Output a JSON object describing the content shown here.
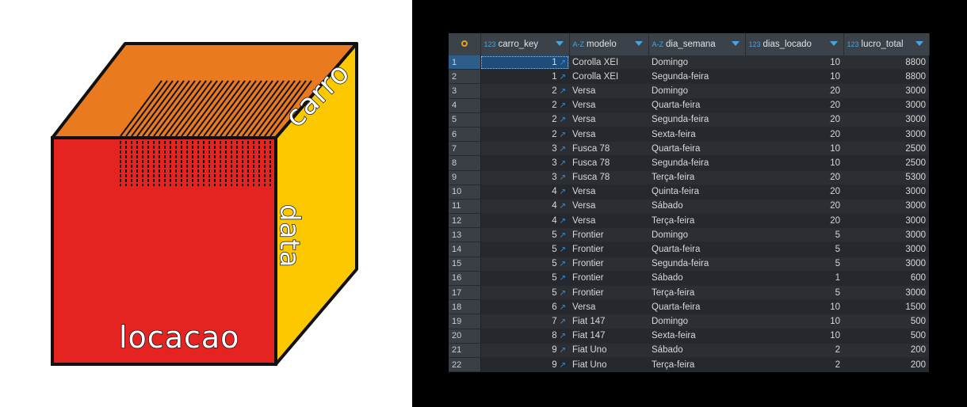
{
  "cube": {
    "labels": {
      "front": "locacao",
      "top": "carro",
      "side": "data"
    },
    "colors": {
      "front": "#e52421",
      "top": "#ea7a1f",
      "side": "#fcc800",
      "outline": "#111111"
    }
  },
  "grid": {
    "columns": [
      {
        "type": "123",
        "name": "carro_key"
      },
      {
        "type": "A-Z",
        "name": "modelo"
      },
      {
        "type": "A-Z",
        "name": "dia_semana"
      },
      {
        "type": "123",
        "name": "dias_locado"
      },
      {
        "type": "123",
        "name": "lucro_total"
      }
    ],
    "selected_row": 1,
    "rows": [
      {
        "n": "1",
        "carro_key": "1",
        "modelo": "Corolla XEI",
        "dia_semana": "Domingo",
        "dias_locado": "10",
        "lucro_total": "8800"
      },
      {
        "n": "2",
        "carro_key": "1",
        "modelo": "Corolla XEI",
        "dia_semana": "Segunda-feira",
        "dias_locado": "10",
        "lucro_total": "8800"
      },
      {
        "n": "3",
        "carro_key": "2",
        "modelo": "Versa",
        "dia_semana": "Domingo",
        "dias_locado": "20",
        "lucro_total": "3000"
      },
      {
        "n": "4",
        "carro_key": "2",
        "modelo": "Versa",
        "dia_semana": "Quarta-feira",
        "dias_locado": "20",
        "lucro_total": "3000"
      },
      {
        "n": "5",
        "carro_key": "2",
        "modelo": "Versa",
        "dia_semana": "Segunda-feira",
        "dias_locado": "20",
        "lucro_total": "3000"
      },
      {
        "n": "6",
        "carro_key": "2",
        "modelo": "Versa",
        "dia_semana": "Sexta-feira",
        "dias_locado": "20",
        "lucro_total": "3000"
      },
      {
        "n": "7",
        "carro_key": "3",
        "modelo": "Fusca 78",
        "dia_semana": "Quarta-feira",
        "dias_locado": "10",
        "lucro_total": "2500"
      },
      {
        "n": "8",
        "carro_key": "3",
        "modelo": "Fusca 78",
        "dia_semana": "Segunda-feira",
        "dias_locado": "10",
        "lucro_total": "2500"
      },
      {
        "n": "9",
        "carro_key": "3",
        "modelo": "Fusca 78",
        "dia_semana": "Terça-feira",
        "dias_locado": "20",
        "lucro_total": "5300"
      },
      {
        "n": "10",
        "carro_key": "4",
        "modelo": "Versa",
        "dia_semana": "Quinta-feira",
        "dias_locado": "20",
        "lucro_total": "3000"
      },
      {
        "n": "11",
        "carro_key": "4",
        "modelo": "Versa",
        "dia_semana": "Sábado",
        "dias_locado": "20",
        "lucro_total": "3000"
      },
      {
        "n": "12",
        "carro_key": "4",
        "modelo": "Versa",
        "dia_semana": "Terça-feira",
        "dias_locado": "20",
        "lucro_total": "3000"
      },
      {
        "n": "13",
        "carro_key": "5",
        "modelo": "Frontier",
        "dia_semana": "Domingo",
        "dias_locado": "5",
        "lucro_total": "3000"
      },
      {
        "n": "14",
        "carro_key": "5",
        "modelo": "Frontier",
        "dia_semana": "Quarta-feira",
        "dias_locado": "5",
        "lucro_total": "3000"
      },
      {
        "n": "15",
        "carro_key": "5",
        "modelo": "Frontier",
        "dia_semana": "Segunda-feira",
        "dias_locado": "5",
        "lucro_total": "3000"
      },
      {
        "n": "16",
        "carro_key": "5",
        "modelo": "Frontier",
        "dia_semana": "Sábado",
        "dias_locado": "1",
        "lucro_total": "600"
      },
      {
        "n": "17",
        "carro_key": "5",
        "modelo": "Frontier",
        "dia_semana": "Terça-feira",
        "dias_locado": "5",
        "lucro_total": "3000"
      },
      {
        "n": "18",
        "carro_key": "6",
        "modelo": "Versa",
        "dia_semana": "Quarta-feira",
        "dias_locado": "10",
        "lucro_total": "1500"
      },
      {
        "n": "19",
        "carro_key": "7",
        "modelo": "Fiat 147",
        "dia_semana": "Domingo",
        "dias_locado": "10",
        "lucro_total": "500"
      },
      {
        "n": "20",
        "carro_key": "8",
        "modelo": "Fiat 147",
        "dia_semana": "Sexta-feira",
        "dias_locado": "10",
        "lucro_total": "500"
      },
      {
        "n": "21",
        "carro_key": "9",
        "modelo": "Fiat Uno",
        "dia_semana": "Sábado",
        "dias_locado": "2",
        "lucro_total": "200"
      },
      {
        "n": "22",
        "carro_key": "9",
        "modelo": "Fiat Uno",
        "dia_semana": "Terça-feira",
        "dias_locado": "2",
        "lucro_total": "200"
      }
    ]
  }
}
